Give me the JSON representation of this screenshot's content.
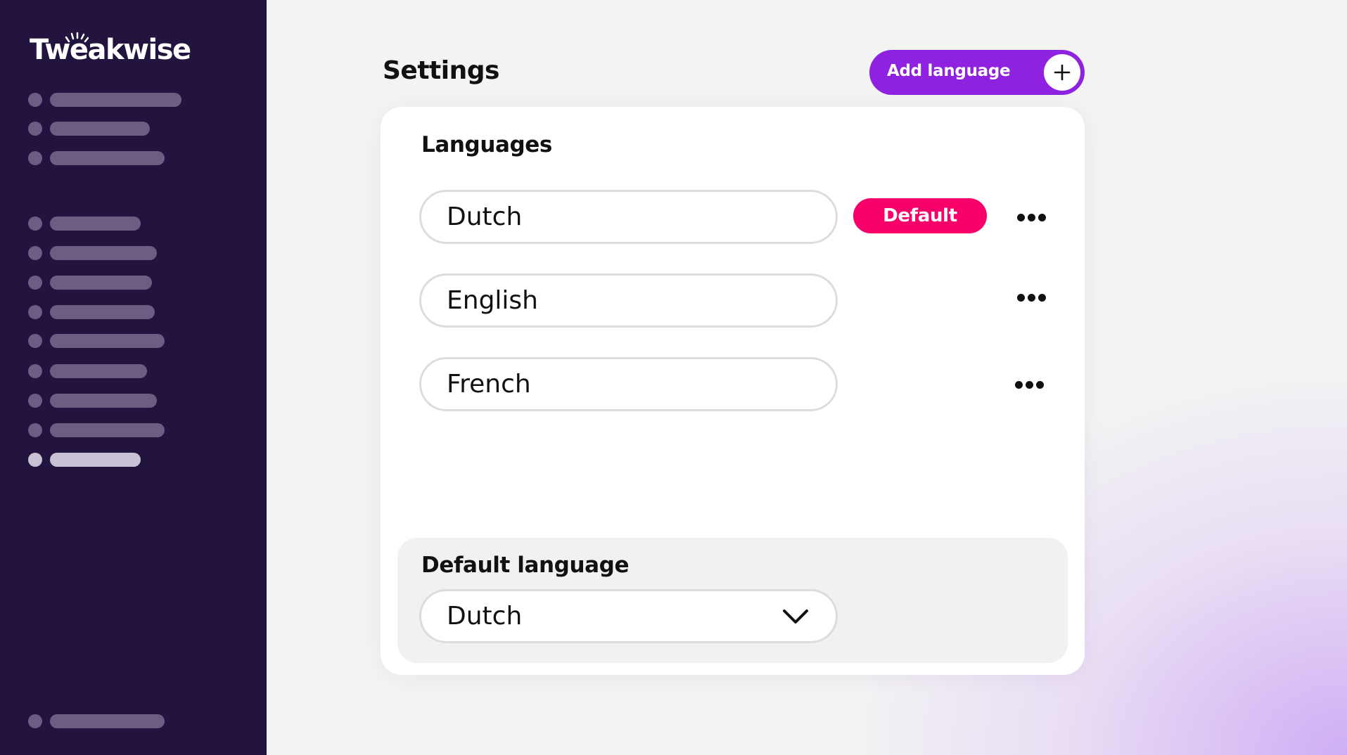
{
  "brand": {
    "logo_text": "Tweakwise"
  },
  "header": {
    "title": "Settings",
    "add_button_label": "Add language"
  },
  "languages_section": {
    "title": "Languages",
    "items": [
      {
        "name": "Dutch",
        "badge": "Default"
      },
      {
        "name": "English",
        "badge": ""
      },
      {
        "name": "French",
        "badge": ""
      }
    ]
  },
  "default_language_section": {
    "title": "Default language",
    "selected": "Dutch"
  },
  "icons": {
    "add": "plus-icon",
    "row_menu": "more-horizontal-icon",
    "select": "chevron-down-icon"
  },
  "colors": {
    "sidebar_bg": "#22133f",
    "accent": "#8e22e0",
    "default_badge": "#f7006a"
  }
}
